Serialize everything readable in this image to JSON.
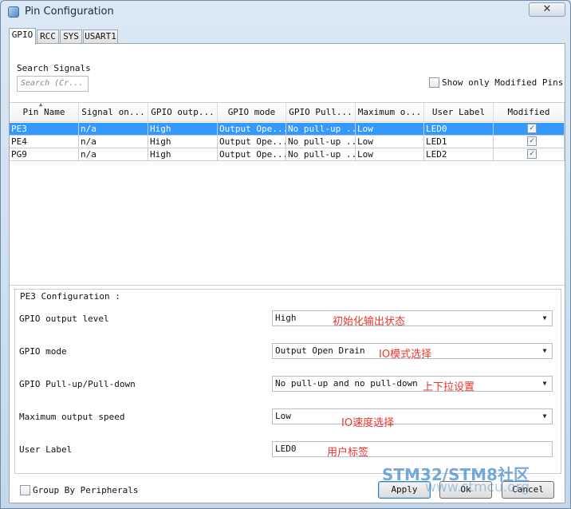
{
  "window": {
    "title": "Pin Configuration",
    "close_glyph": "✕"
  },
  "tabs": [
    {
      "label": "GPIO",
      "active": true
    },
    {
      "label": "RCC"
    },
    {
      "label": "SYS"
    },
    {
      "label": "USART1"
    }
  ],
  "search": {
    "label": "Search Signals",
    "placeholder": "Search (Cr..."
  },
  "show_modified": {
    "label": "Show only Modified Pins",
    "checked": false
  },
  "table": {
    "columns": [
      "Pin Name",
      "Signal on...",
      "GPIO outp...",
      "GPIO mode",
      "GPIO Pull...",
      "Maximum o...",
      "User Label",
      "Modified"
    ],
    "rows": [
      {
        "pin": "PE3",
        "signal": "n/a",
        "output": "High",
        "mode": "Output Ope...",
        "pull": "No pull-up ...",
        "speed": "Low",
        "label": "LED0",
        "modified": true,
        "selected": true
      },
      {
        "pin": "PE4",
        "signal": "n/a",
        "output": "High",
        "mode": "Output Ope...",
        "pull": "No pull-up ...",
        "speed": "Low",
        "label": "LED1",
        "modified": true,
        "selected": false
      },
      {
        "pin": "PG9",
        "signal": "n/a",
        "output": "High",
        "mode": "Output Ope...",
        "pull": "No pull-up ...",
        "speed": "Low",
        "label": "LED2",
        "modified": true,
        "selected": false
      }
    ]
  },
  "config": {
    "title": "PE3 Configuration :",
    "fields": [
      {
        "label": "GPIO output level",
        "value": "High",
        "annotation": "初始化输出状态"
      },
      {
        "label": "GPIO mode",
        "value": "Output Open Drain",
        "annotation": "IO模式选择"
      },
      {
        "label": "GPIO Pull-up/Pull-down",
        "value": "No pull-up and no pull-down",
        "annotation": "上下拉设置"
      },
      {
        "label": "Maximum output speed",
        "value": "Low",
        "annotation": "IO速度选择"
      },
      {
        "label": "User Label",
        "value": "LED0",
        "annotation": "用户标签"
      }
    ]
  },
  "group_by": {
    "label": "Group By Peripherals",
    "checked": false
  },
  "buttons": {
    "apply": "Apply",
    "ok": "Ok",
    "cancel": "Cancel"
  },
  "watermark": {
    "text": "STM32/STM8社区",
    "url": "www.stmcu.org"
  },
  "colors": {
    "selection": "#3399ff",
    "annotation": "#e8362e"
  }
}
